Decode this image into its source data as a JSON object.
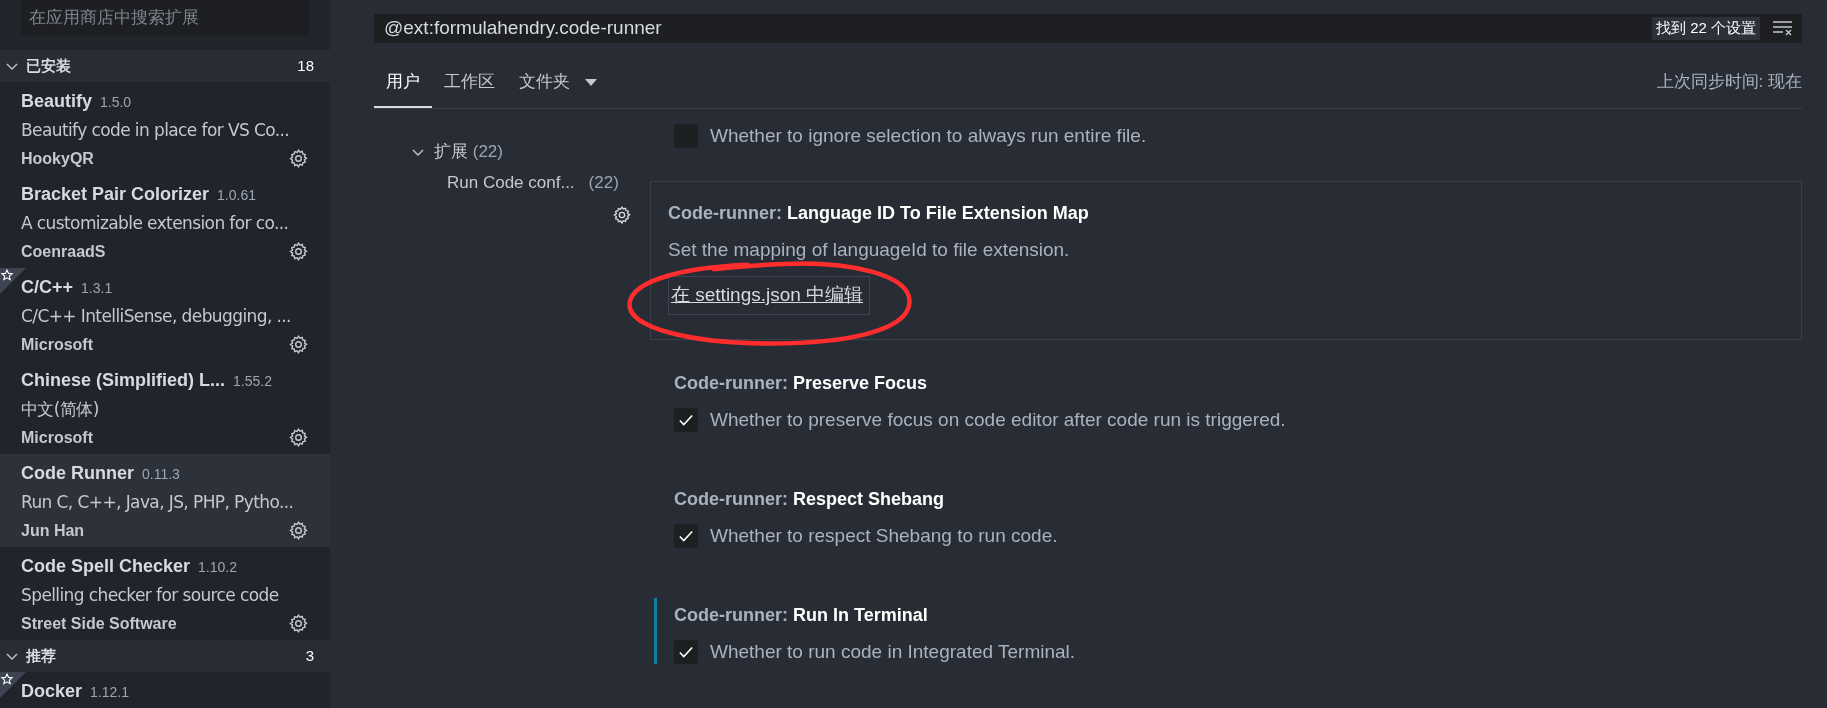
{
  "sidebar": {
    "search": {
      "placeholder": "在应用商店中搜索扩展"
    },
    "sections": [
      {
        "title": "已安装",
        "count": "18",
        "expanded": true,
        "items": [
          {
            "name": "Beautify",
            "version": "1.5.0",
            "description": "Beautify code in place for VS Co...",
            "publisher": "HookyQR",
            "selected": false,
            "starred": false
          },
          {
            "name": "Bracket Pair Colorizer",
            "version": "1.0.61",
            "description": "A customizable extension for co...",
            "publisher": "CoenraadS",
            "selected": false,
            "starred": false
          },
          {
            "name": "C/C++",
            "version": "1.3.1",
            "description": "C/C++ IntelliSense, debugging, ...",
            "publisher": "Microsoft",
            "selected": false,
            "starred": true
          },
          {
            "name": "Chinese (Simplified) L...",
            "version": "1.55.2",
            "description": "中文(简体)",
            "publisher": "Microsoft",
            "selected": false,
            "starred": false
          },
          {
            "name": "Code Runner",
            "version": "0.11.3",
            "description": "Run C, C++, Java, JS, PHP, Pytho...",
            "publisher": "Jun Han",
            "selected": true,
            "starred": false
          },
          {
            "name": "Code Spell Checker",
            "version": "1.10.2",
            "description": "Spelling checker for source code",
            "publisher": "Street Side Software",
            "selected": false,
            "starred": false
          }
        ]
      },
      {
        "title": "推荐",
        "count": "3",
        "expanded": true,
        "items": [
          {
            "name": "Docker",
            "version": "1.12.1",
            "selected": false,
            "starred": true
          }
        ]
      }
    ]
  },
  "settings_search": {
    "value": "@ext:formulahendry.code-runner",
    "result_count": "找到 22 个设置"
  },
  "tabs": [
    {
      "label": "用户",
      "selected": true,
      "has_menu": false
    },
    {
      "label": "工作区",
      "selected": false,
      "has_menu": false
    },
    {
      "label": "文件夹",
      "selected": false,
      "has_menu": true
    }
  ],
  "sync_status": "上次同步时间: 现在",
  "toc": [
    {
      "label": "扩展",
      "count": "(22)",
      "expanded": true,
      "children": [
        {
          "label": "Run Code conf...",
          "count": "(22)"
        }
      ]
    }
  ],
  "settings": [
    {
      "kind": "checkbox",
      "description": "Whether to ignore selection to always run entire file.",
      "checked": false,
      "focused": false
    },
    {
      "kind": "link",
      "category": "Code-runner:",
      "title": "Language ID To File Extension Map",
      "description": "Set the mapping of languageId to file extension.",
      "link": "在 settings.json 中编辑",
      "focused": true
    },
    {
      "kind": "checkbox",
      "category": "Code-runner:",
      "title": "Preserve Focus",
      "description": "Whether to preserve focus on code editor after code run is triggered.",
      "checked": true,
      "focused": false
    },
    {
      "kind": "checkbox",
      "category": "Code-runner:",
      "title": "Respect Shebang",
      "description": "Whether to respect Shebang to run code.",
      "checked": true,
      "focused": false
    },
    {
      "kind": "checkbox",
      "category": "Code-runner:",
      "title": "Run In Terminal",
      "description": "Whether to run code in Integrated Terminal.",
      "checked": true,
      "focused": false,
      "modified": true
    }
  ]
}
